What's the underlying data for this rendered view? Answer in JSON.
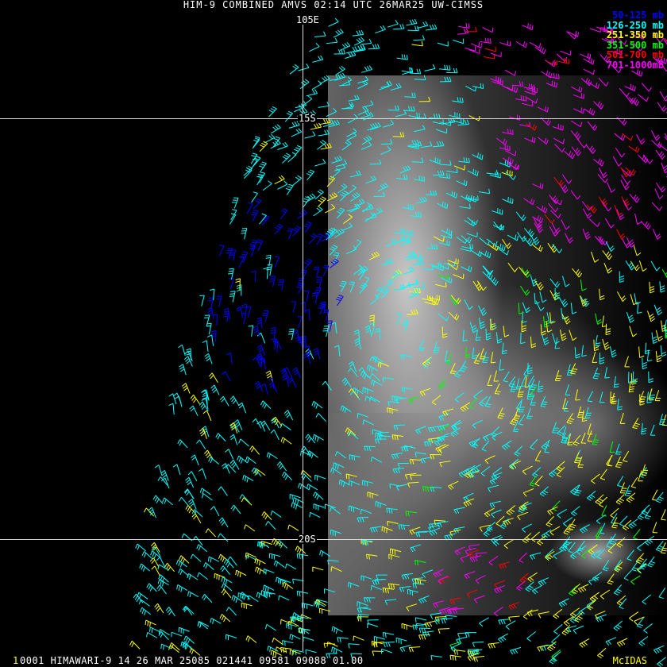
{
  "title": "HIM-9 COMBINED AMVS 02:14 UTC 26MAR25 UW-CIMSS",
  "grid_labels": {
    "lon_105e": "105E",
    "lat_15s": "15S",
    "lat_20s": "20S"
  },
  "legend": [
    {
      "label": "50-125 mb",
      "color": "#0000ff"
    },
    {
      "label": "126-250 mb",
      "color": "#00ffff"
    },
    {
      "label": "251-350 mb",
      "color": "#ffff00"
    },
    {
      "label": "351-500 mb",
      "color": "#00ff00"
    },
    {
      "label": "501-700 mb",
      "color": "#ff0000"
    },
    {
      "label": "701-1000mb",
      "color": "#ff00ff"
    }
  ],
  "footer": {
    "mark": "1",
    "text": "0001 HIMAWARI-9 14 26 MAR 25085 021441 09581 09088 01.00",
    "brand": "McIDAS"
  }
}
